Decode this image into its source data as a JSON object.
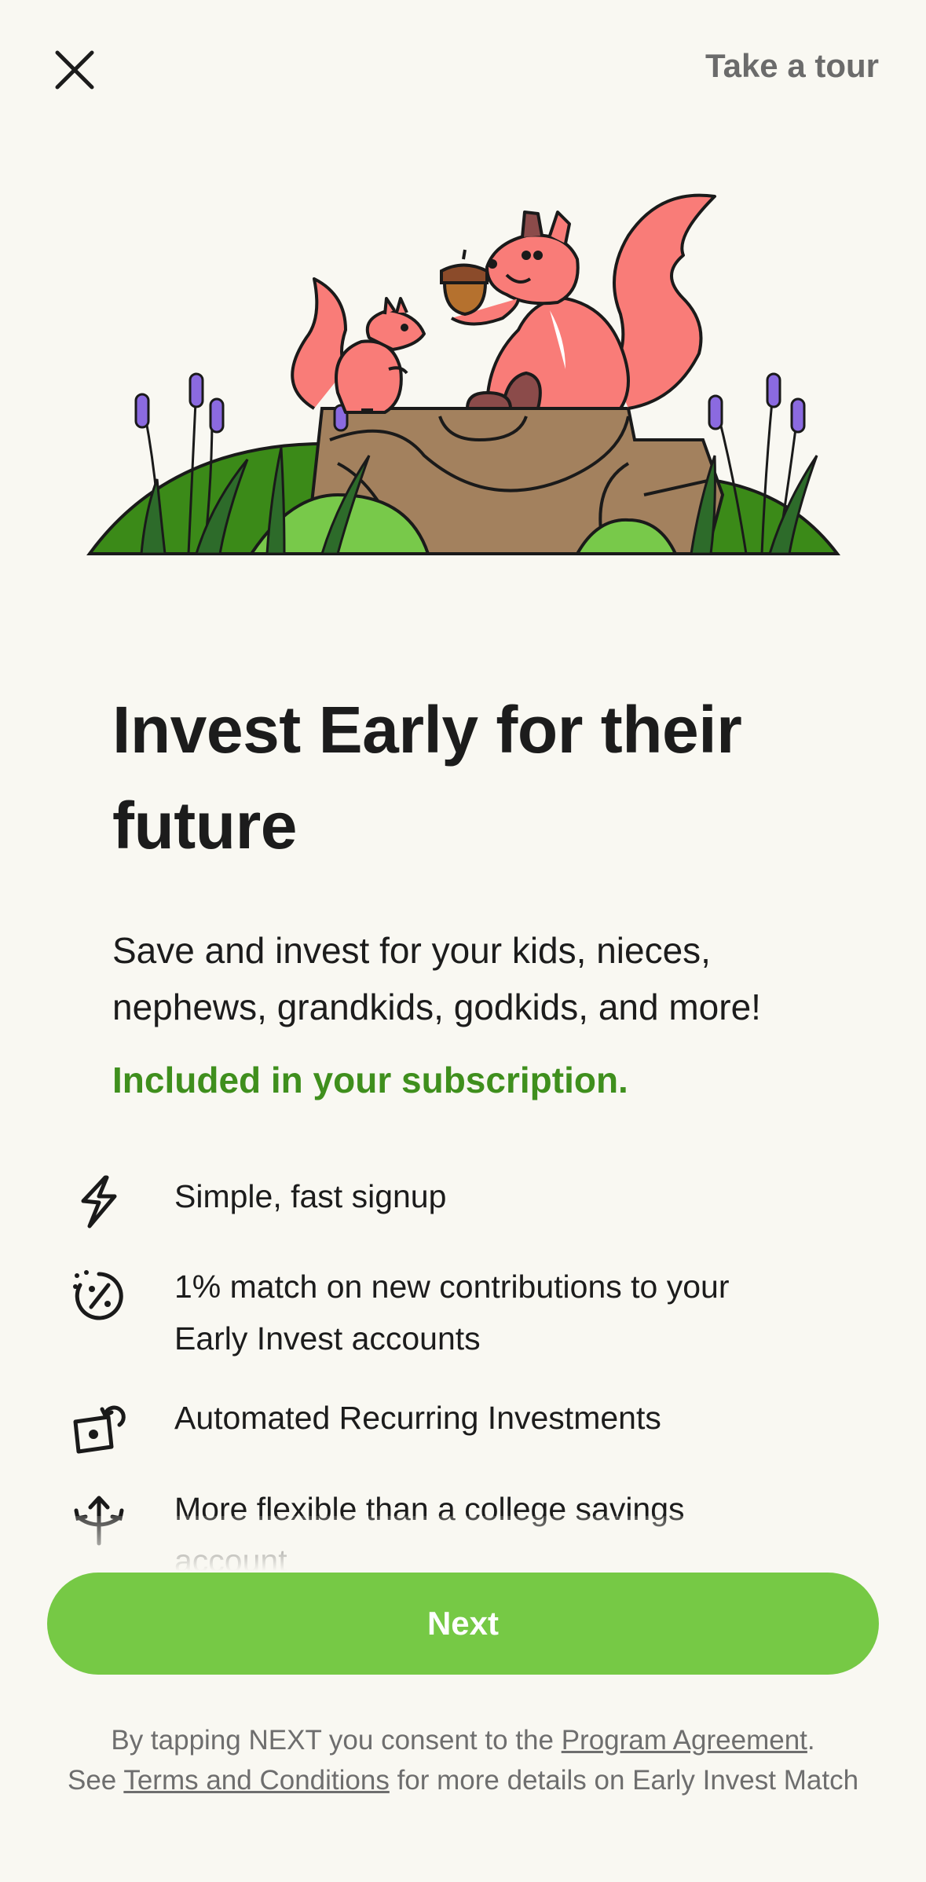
{
  "header": {
    "close_icon": "close-icon",
    "tour_label": "Take a tour"
  },
  "illustration": {
    "description_icon": "squirrels-on-stump-illustration",
    "colors": {
      "squirrel": "#f97c78",
      "stump": "#a3815e",
      "hill_dark": "#3b8a18",
      "hill_light": "#78c94a",
      "flower": "#8b6ae0",
      "acorn": "#b5712e"
    }
  },
  "main": {
    "title": "Invest Early for their future",
    "subtitle": "Save and invest for your kids, nieces, nephews, grandkids, godkids, and more!",
    "included": "Included in your subscription."
  },
  "features": [
    {
      "icon": "lightning-icon",
      "text": "Simple, fast signup"
    },
    {
      "icon": "percent-badge-icon",
      "text": "1% match on new contributions to your Early Invest accounts"
    },
    {
      "icon": "recurring-cash-icon",
      "text": "Automated Recurring Investments"
    },
    {
      "icon": "branching-arrows-icon",
      "text": "More flexible than a college savings account"
    }
  ],
  "cta": {
    "next_label": "Next"
  },
  "legal": {
    "line1_prefix": "By tapping NEXT you consent to the ",
    "program_link": "Program Agreement",
    "line1_suffix": ".",
    "line2_prefix": "See ",
    "terms_link": "Terms and Conditions",
    "line2_suffix": " for more details on Early Invest Match"
  },
  "colors": {
    "background": "#f9f8f2",
    "accent_green": "#76c945",
    "included_green": "#3f8f1d",
    "text": "#1c1c1c",
    "muted": "#6e6e6e"
  }
}
